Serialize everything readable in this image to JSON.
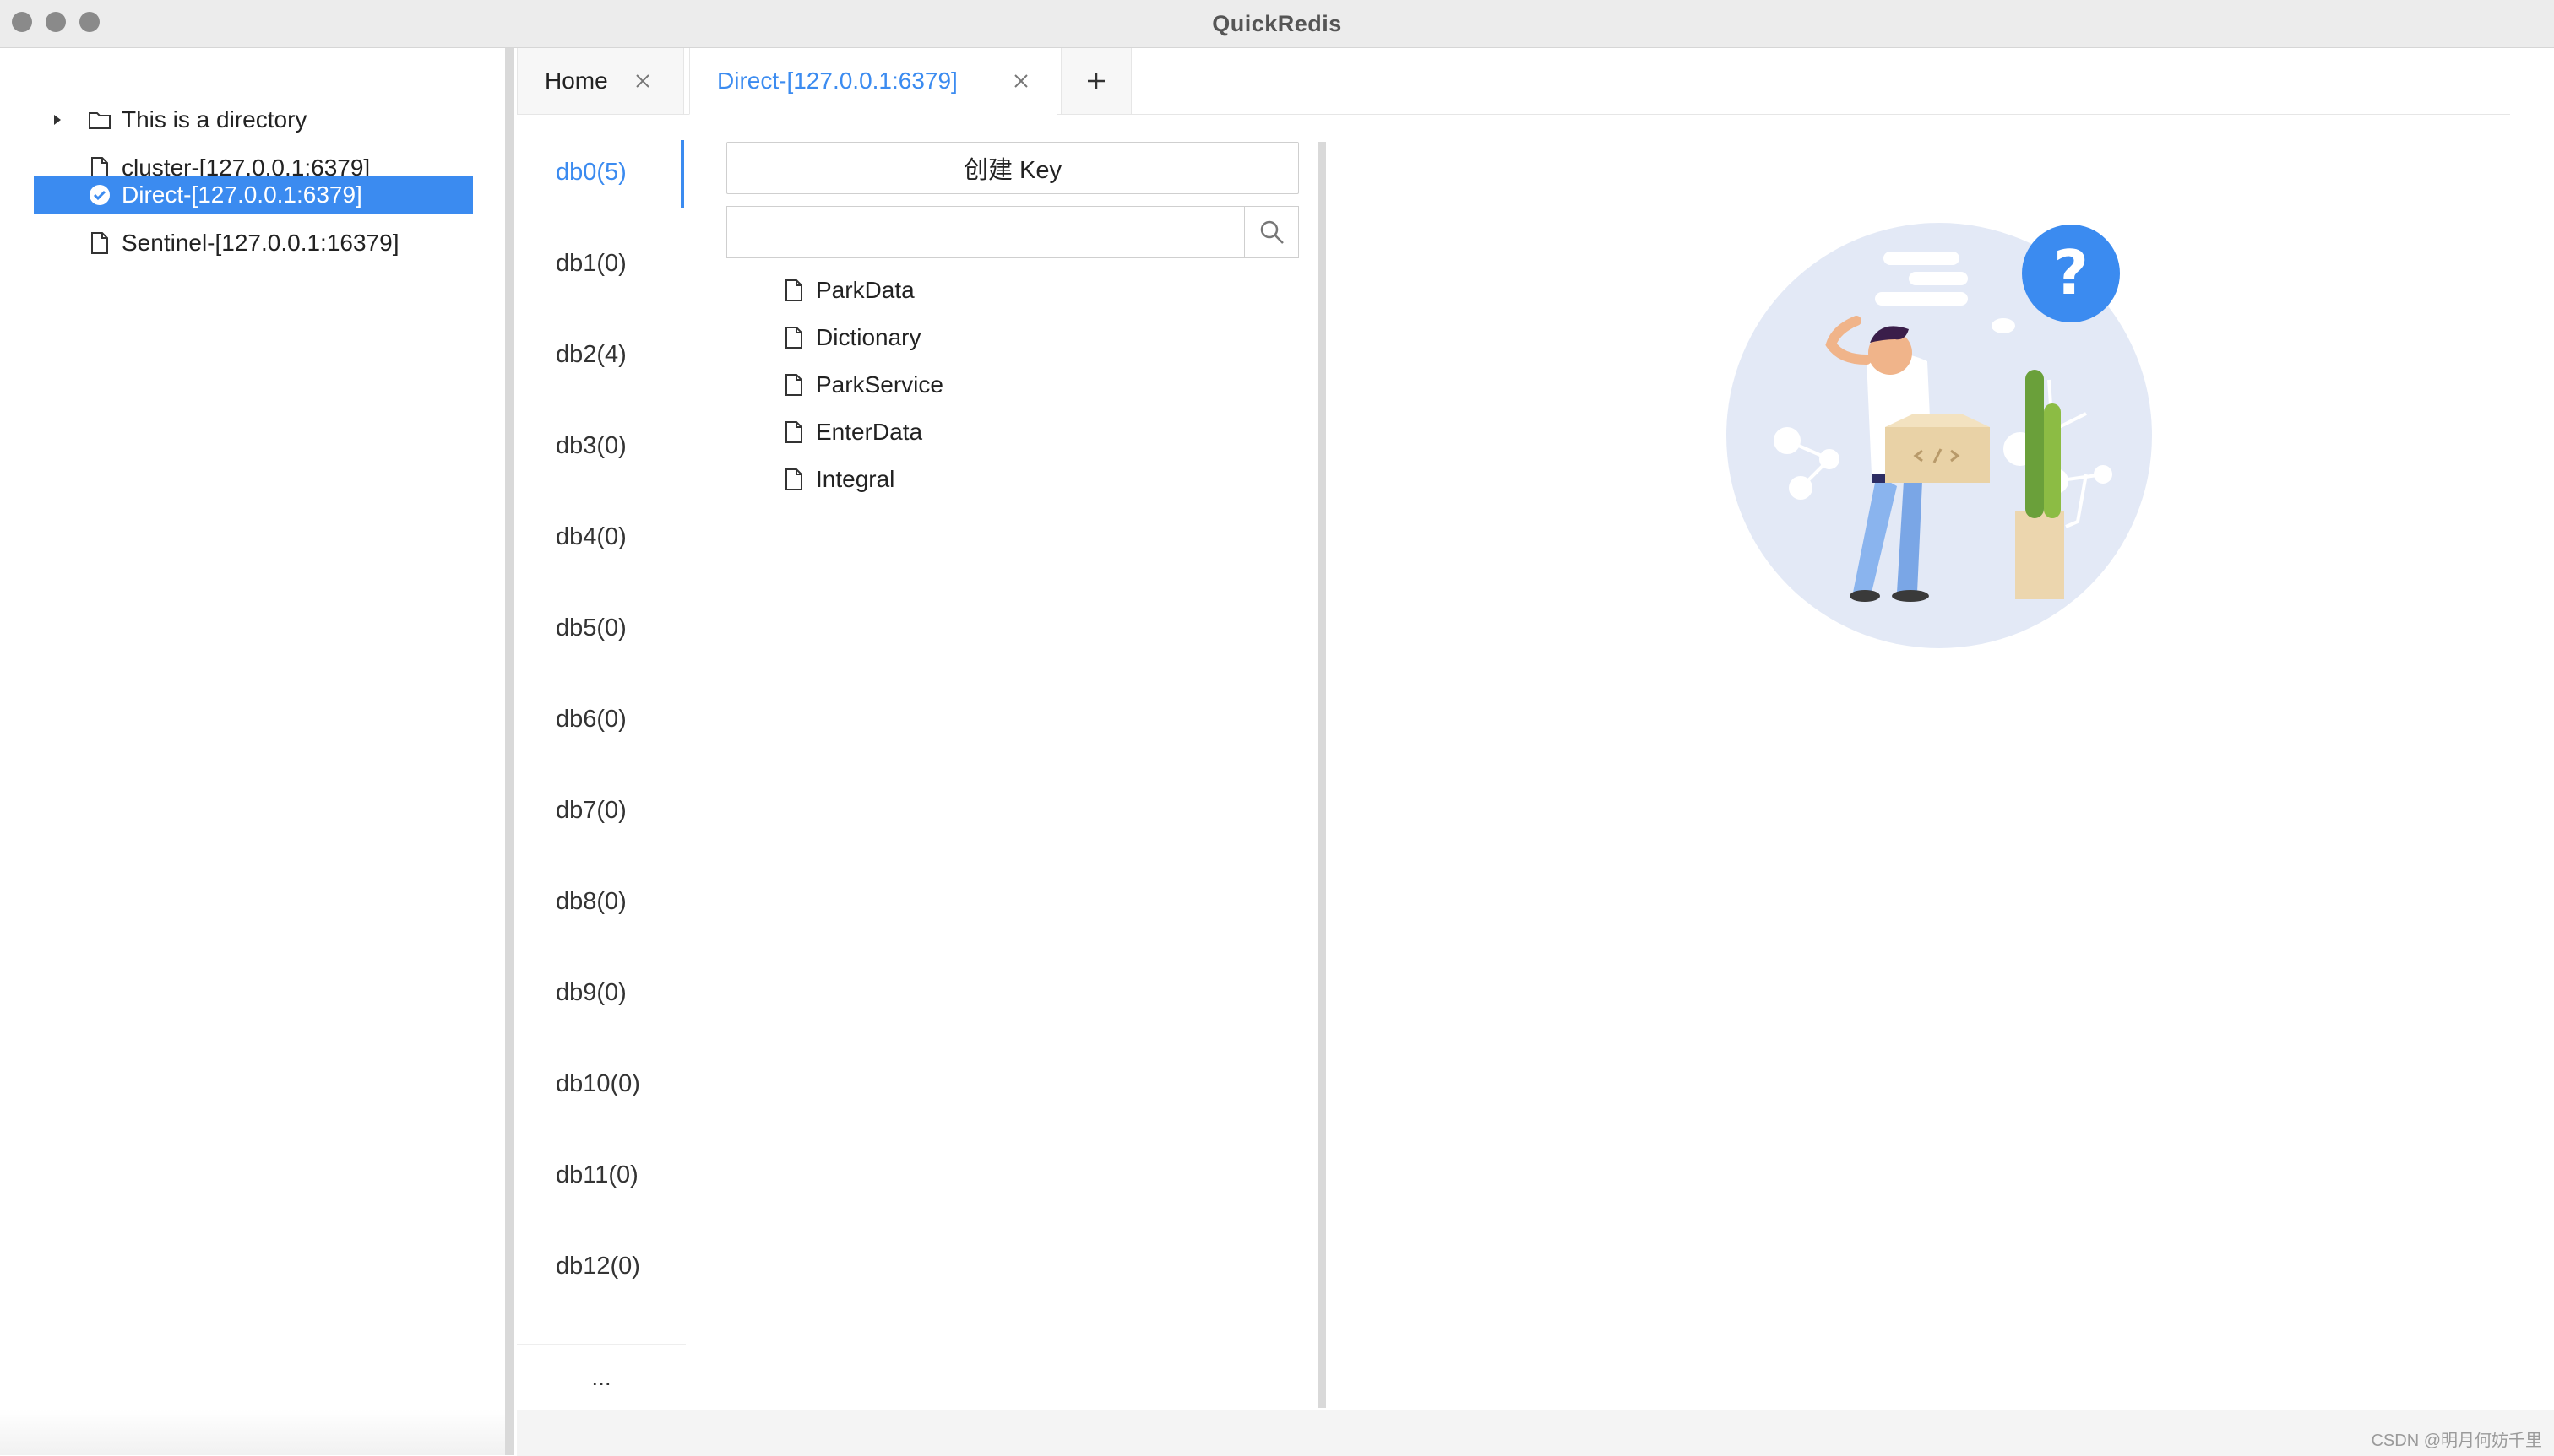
{
  "window": {
    "title": "QuickRedis"
  },
  "tree": {
    "items": [
      {
        "label": "This is a directory",
        "icon": "folder-icon",
        "expandable": true
      },
      {
        "label": "cluster-[127.0.0.1:6379]",
        "icon": "file-icon"
      },
      {
        "label": "Direct-[127.0.0.1:6379]",
        "icon": "check-circle-icon",
        "selected": true
      },
      {
        "label": "Sentinel-[127.0.0.1:16379]",
        "icon": "file-icon"
      }
    ]
  },
  "tabs": [
    {
      "label": "Home",
      "active": false
    },
    {
      "label": "Direct-[127.0.0.1:6379]",
      "active": true
    }
  ],
  "tab_add_label": "+",
  "databases": {
    "items": [
      "db0(5)",
      "db1(0)",
      "db2(4)",
      "db3(0)",
      "db4(0)",
      "db5(0)",
      "db6(0)",
      "db7(0)",
      "db8(0)",
      "db9(0)",
      "db10(0)",
      "db11(0)",
      "db12(0)"
    ],
    "active_index": 0,
    "more_label": "..."
  },
  "keys_panel": {
    "create_button_label": "创建 Key",
    "search_value": "",
    "search_placeholder": "",
    "keys": [
      "ParkData",
      "Dictionary",
      "ParkService",
      "EnterData",
      "Integral"
    ]
  },
  "illustration": {
    "badge_text": "?"
  },
  "footer": {
    "watermark": "CSDN @明月何妨千里"
  },
  "colors": {
    "accent": "#3b8bf0",
    "selected_row": "#3b8bf0"
  }
}
